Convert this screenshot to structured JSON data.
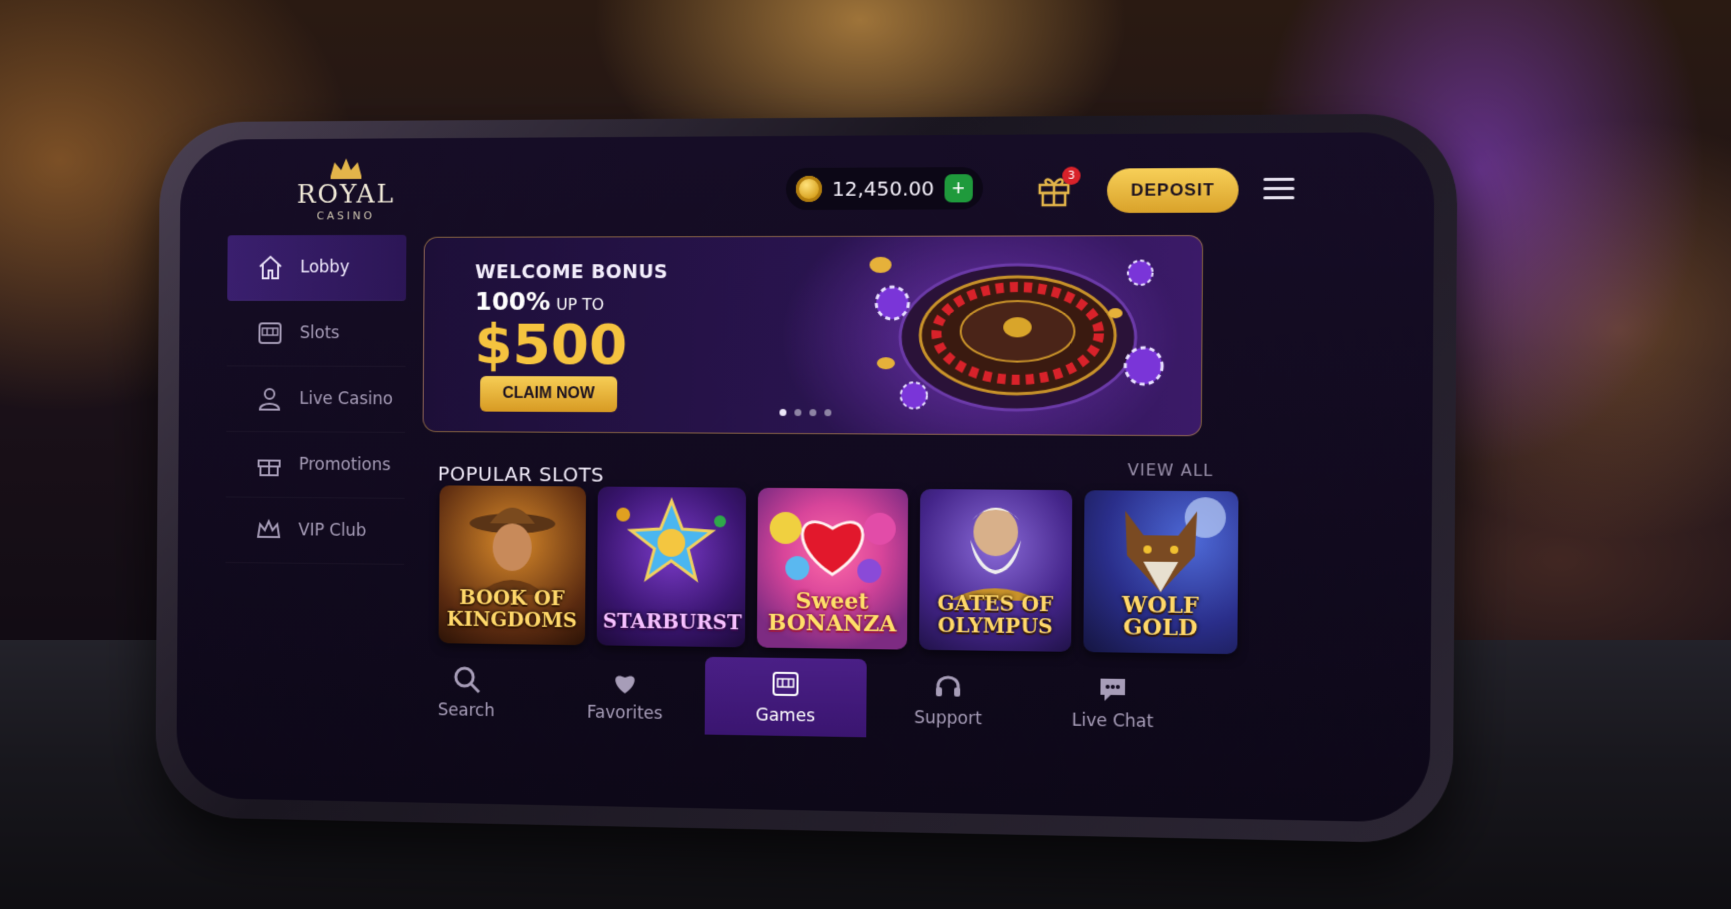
{
  "brand": {
    "title": "ROYAL",
    "subtitle": "CASINO"
  },
  "header": {
    "balance": "12,450.00",
    "add_label": "+",
    "gift_badge": "3",
    "deposit_label": "DEPOSIT"
  },
  "sidebar": {
    "items": [
      {
        "label": "Lobby",
        "icon": "home-icon",
        "active": true
      },
      {
        "label": "Slots",
        "icon": "slot-machine-icon"
      },
      {
        "label": "Live Casino",
        "icon": "dealer-icon"
      },
      {
        "label": "Promotions",
        "icon": "gift-icon"
      },
      {
        "label": "VIP Club",
        "icon": "crown-icon"
      }
    ]
  },
  "banner": {
    "title": "WELCOME BONUS",
    "line": "100%",
    "line_small": "UP TO",
    "amount": "$500",
    "cta": "CLAIM NOW",
    "slides": 4,
    "active_slide": 0
  },
  "popular": {
    "title": "POPULAR SLOTS",
    "view_all": "VIEW ALL",
    "games": [
      {
        "title": "BOOK OF KINGDOMS"
      },
      {
        "title": "STARBURST"
      },
      {
        "title": "Sweet BONANZA"
      },
      {
        "title": "GATES OF OLYMPUS"
      },
      {
        "title": "WOLF GOLD"
      }
    ]
  },
  "bottom_nav": [
    {
      "label": "Search",
      "icon": "search-icon"
    },
    {
      "label": "Favorites",
      "icon": "heart-icon"
    },
    {
      "label": "Games",
      "icon": "slot-machine-icon",
      "active": true
    },
    {
      "label": "Support",
      "icon": "headset-icon"
    },
    {
      "label": "Live Chat",
      "icon": "chat-icon"
    }
  ],
  "colors": {
    "accent_gold": "#f5c33f",
    "panel_purple": "#3a1f6e",
    "bg_dark": "#110a1e",
    "add_green": "#1f9a3c",
    "badge_red": "#d8222a"
  }
}
